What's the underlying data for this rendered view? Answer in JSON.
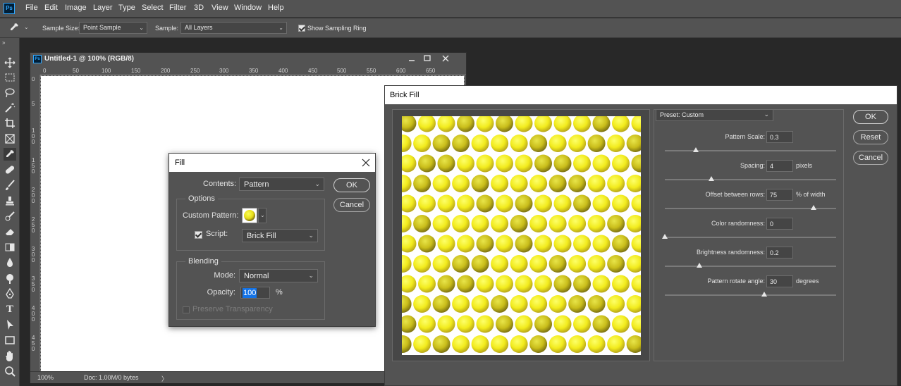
{
  "menu": {
    "logo": "Ps",
    "items": [
      "File",
      "Edit",
      "Image",
      "Layer",
      "Type",
      "Select",
      "Filter",
      "3D",
      "View",
      "Window",
      "Help"
    ]
  },
  "options_bar": {
    "sample_size_label": "Sample Size:",
    "sample_size_value": "Point Sample",
    "sample_label": "Sample:",
    "sample_value": "All Layers",
    "show_ring_label": "Show Sampling Ring"
  },
  "document": {
    "title": "Untitled-1 @ 100% (RGB/8)",
    "logo": "Ps",
    "ruler_top": [
      "0",
      "50",
      "100",
      "150",
      "200",
      "250",
      "300",
      "350",
      "400",
      "450",
      "500",
      "550",
      "600",
      "650"
    ],
    "ruler_left": [
      "0",
      "5",
      "1\n0\n0",
      "1\n5\n0",
      "2\n0\n0",
      "2\n5\n0",
      "3\n0\n0",
      "3\n5\n0",
      "4\n0\n0",
      "4\n5\n0"
    ],
    "zoom": "100%",
    "doc_info": "Doc: 1.00M/0 bytes",
    "chevron": "〉"
  },
  "fill_dialog": {
    "title": "Fill",
    "contents_label": "Contents:",
    "contents_value": "Pattern",
    "options_legend": "Options",
    "custom_pattern_label": "Custom Pattern:",
    "script_label": "Script:",
    "script_value": "Brick Fill",
    "blending_legend": "Blending",
    "mode_label": "Mode:",
    "mode_value": "Normal",
    "opacity_label": "Opacity:",
    "opacity_value": "100",
    "opacity_unit": "%",
    "preserve_label": "Preserve Transparency",
    "ok": "OK",
    "cancel": "Cancel"
  },
  "brick_dialog": {
    "title": "Brick Fill",
    "preset_value": "Preset: Custom",
    "ok": "OK",
    "reset": "Reset",
    "cancel": "Cancel",
    "params": [
      {
        "label": "Pattern Scale:",
        "value": "0.3",
        "unit": "",
        "slider": 0.18
      },
      {
        "label": "Spacing:",
        "value": "4",
        "unit": "pixels",
        "slider": 0.27
      },
      {
        "label": "Offset between rows:",
        "value": "75",
        "unit": "% of width",
        "slider": 0.87
      },
      {
        "label": "Color randomness:",
        "value": "0",
        "unit": "",
        "slider": 0.0
      },
      {
        "label": "Brightness randomness:",
        "value": "0.2",
        "unit": "",
        "slider": 0.2
      },
      {
        "label": "Pattern rotate angle:",
        "value": "30",
        "unit": "degrees",
        "slider": 0.58
      }
    ]
  },
  "colors": {
    "panel": "#535353",
    "workspace": "#282828",
    "ball_bright": "#f7f01d",
    "ball_dark": "#b9a81a",
    "highlight": "#1473e6"
  }
}
